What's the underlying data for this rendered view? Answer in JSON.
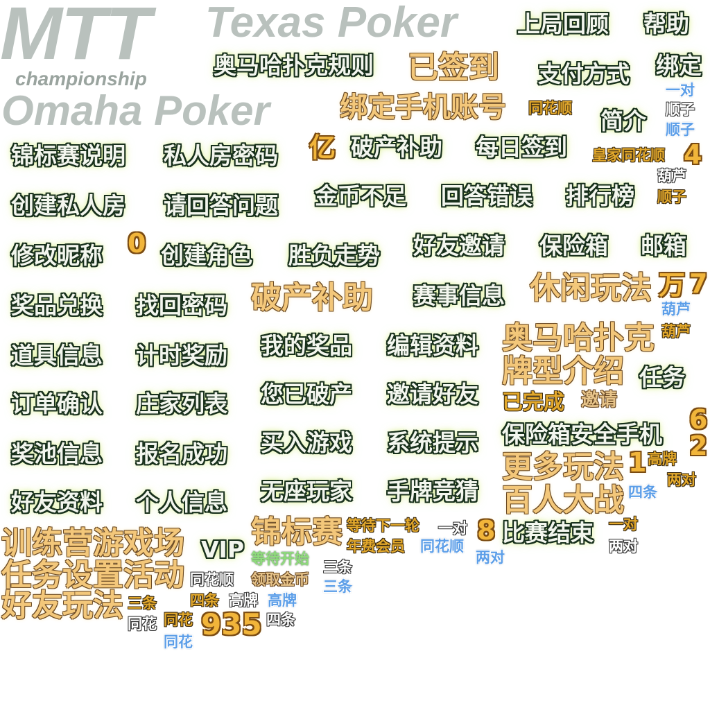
{
  "titles": {
    "mtt": "MTT",
    "texas": "Texas Poker",
    "championship": "championship",
    "omaha": "Omaha Poker"
  },
  "buttons": {
    "last_hand": "上局回顾",
    "help": "帮助",
    "omaha_rules": "奥马哈扑克规则",
    "signed_in": "已签到",
    "payment": "支付方式",
    "bind": "绑定",
    "bind_phone": "绑定手机账号",
    "intro": "简介",
    "tourney_desc": "锦标赛说明",
    "private_pwd": "私人房密码",
    "yi": "亿",
    "bankrupt_aid": "破产补助",
    "daily_signin": "每日签到",
    "create_private": "创建私人房",
    "answer_q": "请回答问题",
    "no_coins": "金币不足",
    "wrong_answer": "回答错误",
    "ranking": "排行榜",
    "edit_nick": "修改昵称",
    "zero": "0",
    "create_role": "创建角色",
    "win_trend": "胜负走势",
    "invite_friend_1": "好友邀请",
    "safe_box": "保险箱",
    "mail": "邮箱",
    "prize_exchange": "奖品兑换",
    "recover_pwd": "找回密码",
    "bankrupt_aid_2": "破产补助",
    "event_info": "赛事信息",
    "casual_play": "休闲玩法",
    "wan": "万",
    "seven": "7",
    "item_info": "道具信息",
    "timed_reward": "计时奖励",
    "my_prizes": "我的奖品",
    "edit_profile": "编辑资料",
    "omaha_poker": "奥马哈扑克",
    "hand_types": "牌型介绍",
    "tasks": "任务",
    "order_confirm": "订单确认",
    "dealer_list": "庄家列表",
    "you_bankrupt": "您已破产",
    "invite_friends": "邀请好友",
    "completed": "已完成",
    "invite": "邀请",
    "jackpot_info": "奖池信息",
    "signup_ok": "报名成功",
    "buy_in": "买入游戏",
    "sys_notice": "系统提示",
    "safe_phone": "保险箱安全手机",
    "six": "6",
    "two": "2",
    "more_play": "更多玩法",
    "one": "1",
    "friend_profile": "好友资料",
    "personal_info": "个人信息",
    "no_seat": "无座玩家",
    "hand_guess": "手牌竞猜",
    "hundred_battle": "百人大战",
    "tourney": "锦标赛",
    "wait_next": "等待下一轮",
    "eight": "8",
    "match_end": "比赛结束",
    "training": "训练营游戏场",
    "vip": "VIP",
    "annual_member": "年费会员",
    "wait_start": "等待开始",
    "task_settings": "任务设置活动",
    "claim_coins": "领取金币",
    "friend_play": "好友玩法",
    "nine_three_five": "935"
  },
  "hands": {
    "straight_flush_1": "同花顺",
    "one_pair_1": "一对",
    "straight_1": "顺子",
    "straight_2": "顺子",
    "royal_flush": "皇家同花顺",
    "four": "4",
    "full_house_1": "葫芦",
    "straight_3": "顺子",
    "full_house_2": "葫芦",
    "full_house_3": "葫芦",
    "high_card_1": "高牌",
    "two_pair_1": "两对",
    "four_kind_1": "四条",
    "one_pair_2": "一对",
    "two_pair_2": "两对",
    "one_pair_3": "一对",
    "straight_flush_2": "同花顺",
    "two_pair_3": "两对",
    "three_kind_1": "三条",
    "straight_flush_3": "同花顺",
    "three_kind_2": "三条",
    "three_kind_3": "三条",
    "four_kind_2": "四条",
    "high_card_2": "高牌",
    "high_card_3": "高牌",
    "flush_1": "同花",
    "flush_2": "同花",
    "four_kind_3": "四条",
    "flush_3": "同花"
  },
  "colors": {
    "outline_dark_green": "#18301c",
    "glow_yellow": "#cdeb5f",
    "gold": "#f3c77a",
    "hand_gold": "#e2a82c",
    "hand_blue": "#5c9ee8",
    "title_grey": "#b9c1bd"
  }
}
